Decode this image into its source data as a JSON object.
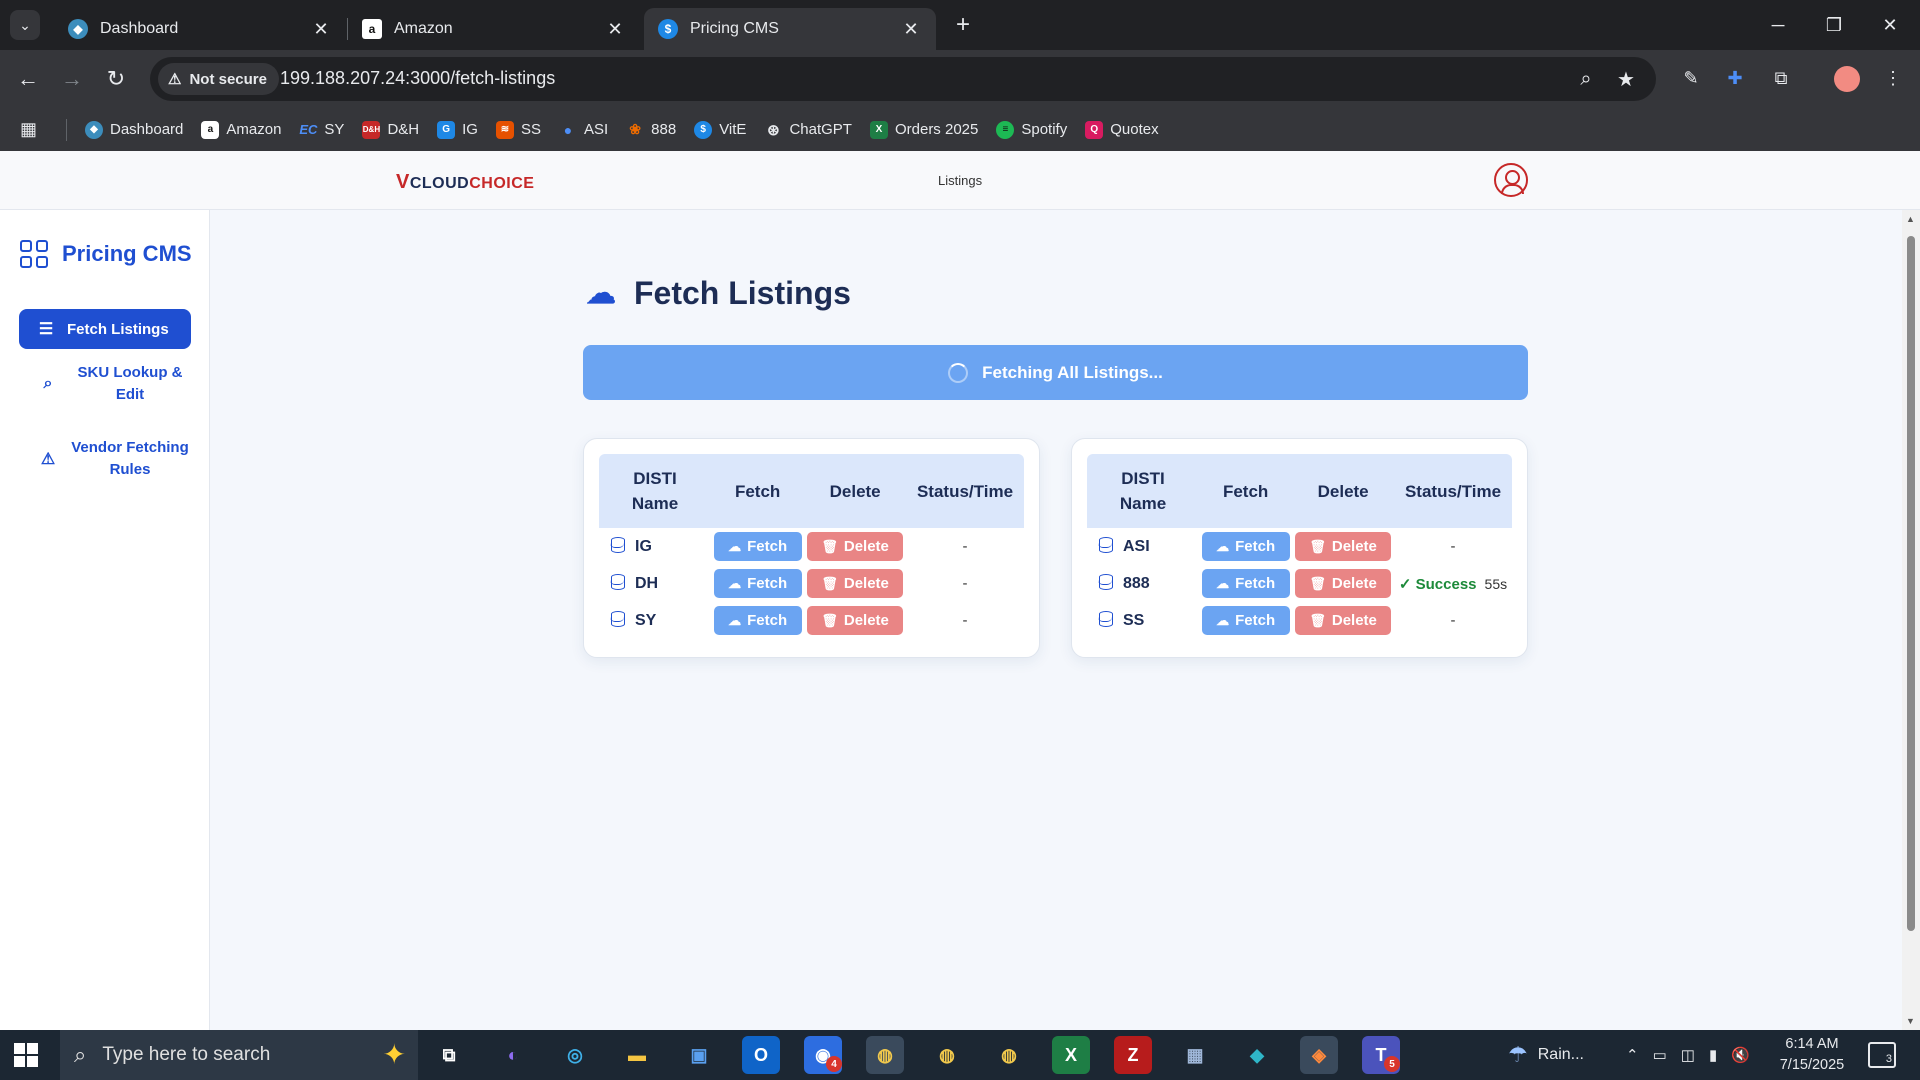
{
  "browser": {
    "tabs": [
      {
        "title": "Dashboard",
        "favicon_color": "#3c8dbc",
        "active": false
      },
      {
        "title": "Amazon",
        "favicon_color": "#ffffff",
        "active": false
      },
      {
        "title": "Pricing CMS",
        "favicon_color": "#1e88e5",
        "active": true
      }
    ],
    "address": {
      "security_label": "Not secure",
      "url": "199.188.207.24:3000/fetch-listings"
    },
    "bookmarks": [
      {
        "label": "Dashboard",
        "icon": "hexagon-icon",
        "color": "#3c8dbc"
      },
      {
        "label": "Amazon",
        "icon": "amazon-icon",
        "color": "#ffffff"
      },
      {
        "label": "SY",
        "icon": "ec-icon",
        "color": "#1565c0"
      },
      {
        "label": "D&H",
        "icon": "dh-icon",
        "color": "#c62828"
      },
      {
        "label": "IG",
        "icon": "ig-icon",
        "color": "#1e88e5"
      },
      {
        "label": "SS",
        "icon": "ss-icon",
        "color": "#e65100"
      },
      {
        "label": "ASI",
        "icon": "asi-icon",
        "color": "#1565c0"
      },
      {
        "label": "888",
        "icon": "888-icon",
        "color": "#ef6c00"
      },
      {
        "label": "VitE",
        "icon": "dollar-icon",
        "color": "#1e88e5"
      },
      {
        "label": "ChatGPT",
        "icon": "chatgpt-icon",
        "color": "#e8eaed"
      },
      {
        "label": "Orders 2025",
        "icon": "excel-icon",
        "color": "#1e7e45"
      },
      {
        "label": "Spotify",
        "icon": "spotify-icon",
        "color": "#1db954"
      },
      {
        "label": "Quotex",
        "icon": "quotex-icon",
        "color": "#d81b60"
      }
    ]
  },
  "app": {
    "brand_prefix": "V",
    "brand_cloud": "CLOUD",
    "brand_choice": "CHOICE",
    "nav_listings": "Listings"
  },
  "sidebar": {
    "title": "Pricing CMS",
    "items": [
      {
        "label": "Fetch Listings",
        "icon": "list-icon",
        "active": true
      },
      {
        "label": "SKU Lookup & Edit",
        "icon": "search-icon",
        "active": false
      },
      {
        "label": "Vendor Fetching Rules",
        "icon": "warning-icon",
        "active": false
      }
    ]
  },
  "main": {
    "title": "Fetch Listings",
    "fetch_all_label": "Fetching All Listings...",
    "columns": {
      "name": "DISTI Name",
      "fetch": "Fetch",
      "delete": "Delete",
      "status": "Status/Time"
    },
    "fetch_label": "Fetch",
    "delete_label": "Delete",
    "tables": [
      {
        "rows": [
          {
            "name": "IG",
            "status": "-",
            "time": ""
          },
          {
            "name": "DH",
            "status": "-",
            "time": ""
          },
          {
            "name": "SY",
            "status": "-",
            "time": ""
          }
        ]
      },
      {
        "rows": [
          {
            "name": "ASI",
            "status": "-",
            "time": ""
          },
          {
            "name": "888",
            "status": "Success",
            "time": "55s"
          },
          {
            "name": "SS",
            "status": "-",
            "time": ""
          }
        ]
      }
    ]
  },
  "taskbar": {
    "search_placeholder": "Type here to search",
    "weather": "Rain...",
    "time": "6:14 AM",
    "date": "7/15/2025",
    "notification_count": "3",
    "badges": {
      "zoom": "4",
      "teams": "5"
    }
  }
}
